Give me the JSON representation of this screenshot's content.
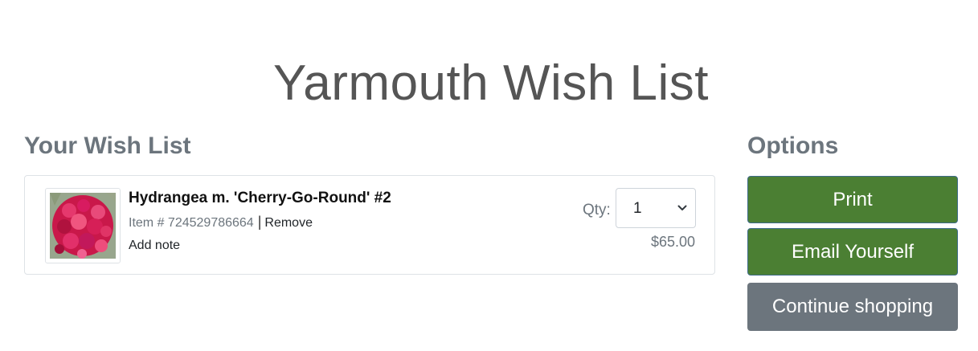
{
  "page": {
    "title": "Yarmouth Wish List"
  },
  "wishlist": {
    "heading": "Your Wish List",
    "items": [
      {
        "name": "Hydrangea m. 'Cherry-Go-Round' #2",
        "item_prefix": "Item #",
        "item_number": "724529786664",
        "separator": "|",
        "remove_label": "Remove",
        "add_note_label": "Add note",
        "qty_label": "Qty:",
        "qty_value": "1",
        "price": "$65.00",
        "image_icon": "hydrangea-photo"
      }
    ]
  },
  "options": {
    "heading": "Options",
    "print_label": "Print",
    "email_label": "Email Yourself",
    "continue_label": "Continue shopping"
  },
  "colors": {
    "primary_green": "#4b7f33",
    "secondary_gray": "#6c757d",
    "title_gray": "#555555"
  }
}
